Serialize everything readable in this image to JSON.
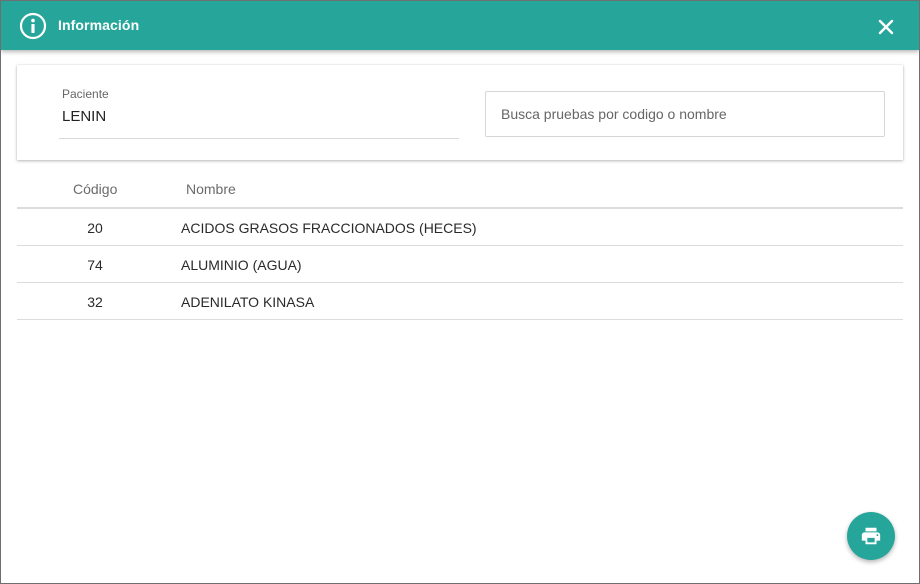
{
  "header": {
    "title": "Información",
    "icon": "info-icon",
    "close_icon": "close-icon",
    "color": "#26a69a"
  },
  "patient": {
    "label": "Paciente",
    "value": "LENIN"
  },
  "search": {
    "placeholder": "Busca pruebas por codigo o nombre",
    "value": ""
  },
  "table": {
    "columns": [
      "Código",
      "Nombre"
    ],
    "rows": [
      {
        "code": "20",
        "name": "ACIDOS GRASOS FRACCIONADOS (HECES)"
      },
      {
        "code": "74",
        "name": "ALUMINIO (AGUA)"
      },
      {
        "code": "32",
        "name": "ADENILATO KINASA"
      }
    ]
  },
  "fab": {
    "icon": "print-icon",
    "color": "#26a69a"
  }
}
